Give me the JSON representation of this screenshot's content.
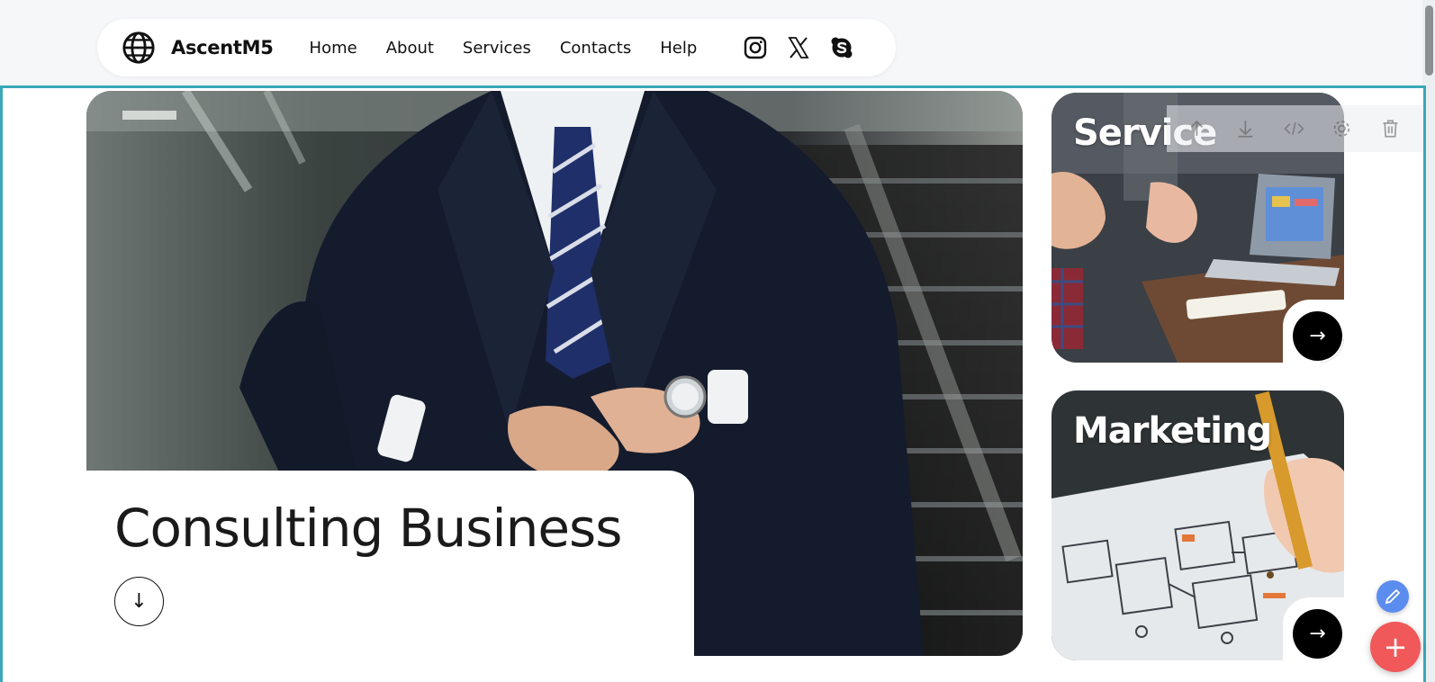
{
  "brand": {
    "name": "AscentM5",
    "logo_icon": "globe-icon"
  },
  "nav": {
    "items": [
      {
        "label": "Home"
      },
      {
        "label": "About"
      },
      {
        "label": "Services"
      },
      {
        "label": "Contacts"
      },
      {
        "label": "Help"
      }
    ],
    "socials": [
      "instagram-icon",
      "x-twitter-icon",
      "skype-icon"
    ]
  },
  "hero": {
    "title": "Consulting Business",
    "scroll_icon": "↓"
  },
  "cards": [
    {
      "title": "Service",
      "arrow": "→"
    },
    {
      "title": "Marketing",
      "arrow": "→"
    }
  ],
  "editor": {
    "toolbar": [
      "move-up-icon",
      "move-down-icon",
      "code-icon",
      "settings-icon",
      "delete-icon"
    ],
    "frame_color": "#3aa8b6",
    "fab_add_label": "+"
  },
  "colors": {
    "accent_edit": "#5b8def",
    "accent_add": "#f0585a"
  }
}
